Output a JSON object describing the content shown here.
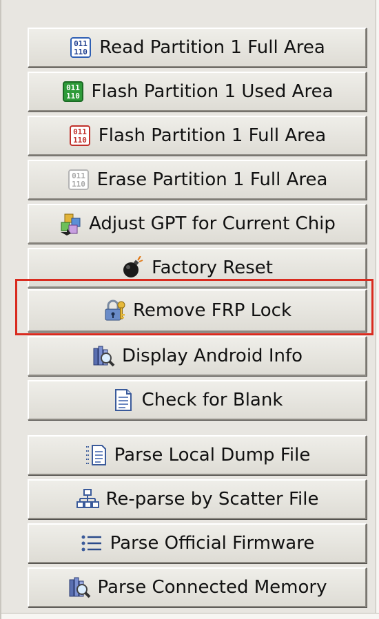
{
  "buttons": [
    {
      "id": "read-partition-1-full-area",
      "label": "Read Partition 1 Full Area",
      "icon": "binary-blue-icon"
    },
    {
      "id": "flash-partition-1-used-area",
      "label": "Flash Partition 1 Used Area",
      "icon": "binary-green-icon"
    },
    {
      "id": "flash-partition-1-full-area",
      "label": "Flash Partition 1 Full Area",
      "icon": "binary-red-icon"
    },
    {
      "id": "erase-partition-1-full-area",
      "label": "Erase Partition 1 Full Area",
      "icon": "binary-gray-icon"
    },
    {
      "id": "adjust-gpt",
      "label": "Adjust GPT for Current Chip",
      "icon": "chip-cubes-icon"
    },
    {
      "id": "factory-reset",
      "label": "Factory Reset",
      "icon": "bomb-icon"
    },
    {
      "id": "remove-frp-lock",
      "label": "Remove FRP Lock",
      "icon": "lock-key-icon",
      "highlighted": true
    },
    {
      "id": "display-android-info",
      "label": "Display Android Info",
      "icon": "info-magnifier-icon"
    },
    {
      "id": "check-for-blank",
      "label": "Check for Blank",
      "icon": "document-icon"
    },
    {
      "id": "parse-local-dump-file",
      "label": "Parse Local Dump File",
      "icon": "list-document-icon"
    },
    {
      "id": "re-parse-by-scatter-file",
      "label": "Re-parse by Scatter File",
      "icon": "tree-structure-icon"
    },
    {
      "id": "parse-official-firmware",
      "label": "Parse Official Firmware",
      "icon": "list-icon"
    },
    {
      "id": "parse-connected-memory",
      "label": "Parse Connected Memory",
      "icon": "memory-magnifier-icon"
    }
  ],
  "colors": {
    "panel": "#e8e6e1",
    "highlight_border": "#d92b1f"
  }
}
